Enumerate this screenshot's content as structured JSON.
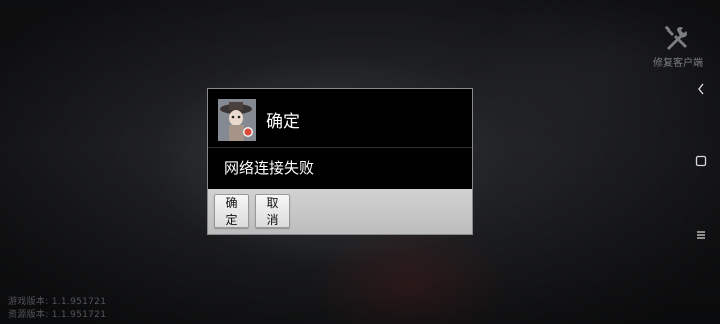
{
  "top_right": {
    "repair_label": "修复客户端",
    "repair_icon": "tools-icon"
  },
  "right_nav": {
    "back_icon": "chevron-left-icon",
    "home_icon": "square-icon",
    "menu_icon": "menu-icon"
  },
  "version": {
    "game_version": "游戏版本: 1.1.951721",
    "resource_version": "资源版本: 1.1.951721"
  },
  "dialog": {
    "title": "确定",
    "message": "网络连接失败",
    "ok_label": "确定",
    "cancel_label": "取消"
  },
  "colors": {
    "dialog_bg": "#000000",
    "footer_bg": "#c8c8c8",
    "text": "#ffffff"
  }
}
